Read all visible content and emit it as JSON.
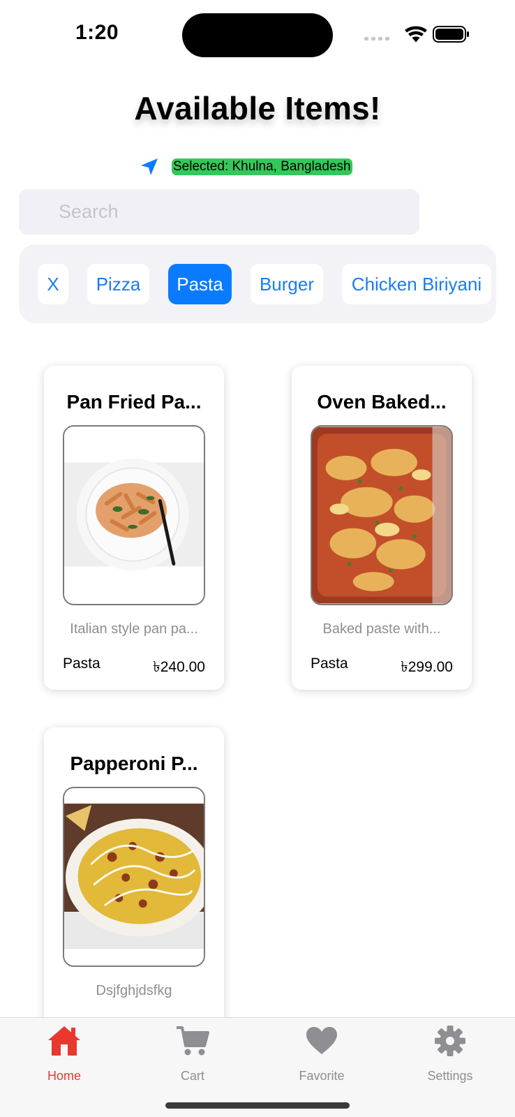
{
  "status_bar": {
    "time": "1:20"
  },
  "header": {
    "title": "Available Items!"
  },
  "location": {
    "text": "Selected: Khulna, Bangladesh",
    "badge_color": "#34c759"
  },
  "search": {
    "placeholder": "Search",
    "value": ""
  },
  "categories": [
    {
      "label": "X",
      "active": false
    },
    {
      "label": "Pizza",
      "active": false
    },
    {
      "label": "Pasta",
      "active": true
    },
    {
      "label": "Burger",
      "active": false
    },
    {
      "label": "Chicken Biriyani",
      "active": false
    }
  ],
  "items": [
    {
      "title": "Pan Fried Pa...",
      "description": "Italian style pan pa...",
      "category": "Pasta",
      "price": "৳240.00"
    },
    {
      "title": "Oven Baked...",
      "description": "Baked paste with...",
      "category": "Pasta",
      "price": "৳299.00"
    },
    {
      "title": "Papperoni P...",
      "description": "Dsjfghjdsfkg",
      "category": "",
      "price": ""
    }
  ],
  "tabs": [
    {
      "label": "Home",
      "icon": "house-icon",
      "active": true
    },
    {
      "label": "Cart",
      "icon": "cart-icon",
      "active": false
    },
    {
      "label": "Favorite",
      "icon": "heart-icon",
      "active": false
    },
    {
      "label": "Settings",
      "icon": "gear-icon",
      "active": false
    }
  ],
  "colors": {
    "accent": "#0a7bff",
    "active_tab": "#e8382f",
    "inactive_tab": "#8e8e93"
  }
}
